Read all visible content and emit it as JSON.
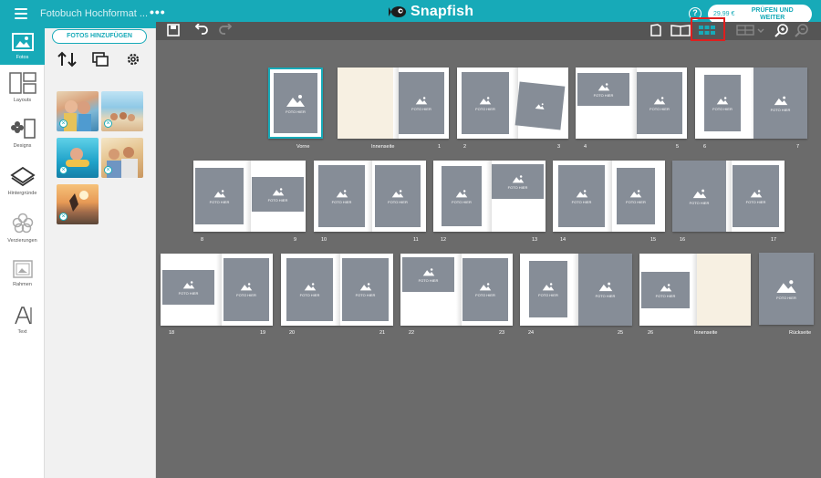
{
  "header": {
    "doc_title": "Fotobuch Hochformat ...",
    "more": "•••",
    "brand": "Snapfish",
    "help": "?",
    "price": "29,99 €",
    "checkout_label": "PRÜFEN UND WEITER",
    "accent": "#17aab8"
  },
  "rail": [
    {
      "label": "Fotos",
      "icon": "photos-icon",
      "active": true
    },
    {
      "label": "Layouts",
      "icon": "layouts-icon"
    },
    {
      "label": "Designs",
      "icon": "designs-icon"
    },
    {
      "label": "Hintergründe",
      "icon": "backgrounds-icon"
    },
    {
      "label": "Verzierungen",
      "icon": "embellishments-icon"
    },
    {
      "label": "Rahmen",
      "icon": "frames-icon"
    },
    {
      "label": "Text",
      "icon": "text-icon"
    }
  ],
  "photos_panel": {
    "add_button": "FOTOS HINZUFÜGEN",
    "tools": [
      "sort-icon",
      "autofill-icon",
      "settings-icon"
    ],
    "photo_count": 5
  },
  "toolbar": {
    "icons": [
      "save-icon",
      "undo-icon",
      "redo-icon",
      "single-page-view-icon",
      "spread-view-icon",
      "grid-view-icon",
      "layout-select-icon",
      "zoom-in-icon",
      "zoom-out-icon"
    ],
    "active": "grid-view-icon"
  },
  "placeholder_text": "FOTO HIER",
  "spreads": {
    "row1": [
      {
        "left": "",
        "right": "Vorne"
      },
      {
        "left": "Innenseite",
        "right": "1"
      },
      {
        "left": "2",
        "right": "3"
      },
      {
        "left": "4",
        "right": "5"
      },
      {
        "left": "6",
        "right": "7"
      }
    ],
    "row2": [
      {
        "left": "8",
        "right": "9"
      },
      {
        "left": "10",
        "right": "11"
      },
      {
        "left": "12",
        "right": "13"
      },
      {
        "left": "14",
        "right": "15"
      },
      {
        "left": "16",
        "right": "17"
      }
    ],
    "row3": [
      {
        "left": "18",
        "right": "19"
      },
      {
        "left": "20",
        "right": "21"
      },
      {
        "left": "22",
        "right": "23"
      },
      {
        "left": "24",
        "right": "25"
      },
      {
        "left": "26",
        "right": "Innenseite"
      },
      {
        "left": "",
        "right": "Rückseite"
      }
    ]
  }
}
